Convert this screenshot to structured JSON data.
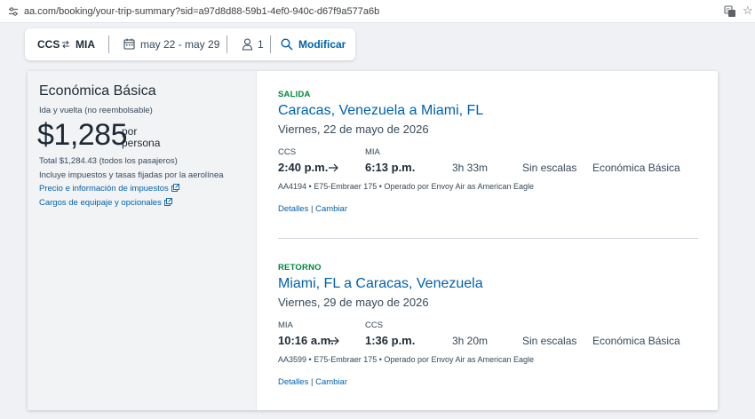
{
  "browser": {
    "url": "aa.com/booking/your-trip-summary?sid=a97d8d88-59b1-4ef0-940c-d67f9a577a6b"
  },
  "search": {
    "origin": "CCS",
    "destination": "MIA",
    "dates": "may 22 - may 29",
    "passengers": "1",
    "modify_label": "Modificar"
  },
  "fare": {
    "title": "Económica Básica",
    "subtitle": "Ida y vuelta (no reembolsable)",
    "price": "$1,285",
    "per": "por",
    "person": "persona",
    "total": "Total $1,284.43 (todos los pasajeros)",
    "taxes_note": "Incluye impuestos y tasas fijadas por la aerolínea",
    "price_info_link": "Precio e información de impuestos",
    "baggage_link": "Cargos de equipaje y opcionales"
  },
  "outbound": {
    "label": "SALIDA",
    "route": "Caracas, Venezuela a Miami, FL",
    "date": "Viernes, 22 de mayo de 2026",
    "dep_code": "CCS",
    "dep_time": "2:40 p.m.",
    "arr_code": "MIA",
    "arr_time": "6:13 p.m.",
    "duration": "3h 33m",
    "stops": "Sin escalas",
    "cabin": "Económica Básica",
    "flight": "AA4194",
    "aircraft": "E75-Embraer 175",
    "operator": "Operado por Envoy Air as American Eagle",
    "details_link": "Detalles",
    "change_link": "Cambiar"
  },
  "return": {
    "label": "RETORNO",
    "route": "Miami, FL a Caracas, Venezuela",
    "date": "Viernes, 29 de mayo de 2026",
    "dep_code": "MIA",
    "dep_time": "10:16 a.m.",
    "arr_code": "CCS",
    "arr_time": "1:36 p.m.",
    "duration": "3h 20m",
    "stops": "Sin escalas",
    "cabin": "Económica Básica",
    "flight": "AA3599",
    "aircraft": "E75-Embraer 175",
    "operator": "Operado por Envoy Air as American Eagle",
    "details_link": "Detalles",
    "change_link": "Cambiar"
  },
  "colors": {
    "brand_blue": "#0061ab",
    "segment_green": "#00853f"
  },
  "icons": [
    "site-settings-icon",
    "translate-icon",
    "bookmark-star-icon",
    "swap-icon",
    "calendar-icon",
    "person-icon",
    "search-icon",
    "external-link-icon",
    "right-arrow-icon"
  ]
}
